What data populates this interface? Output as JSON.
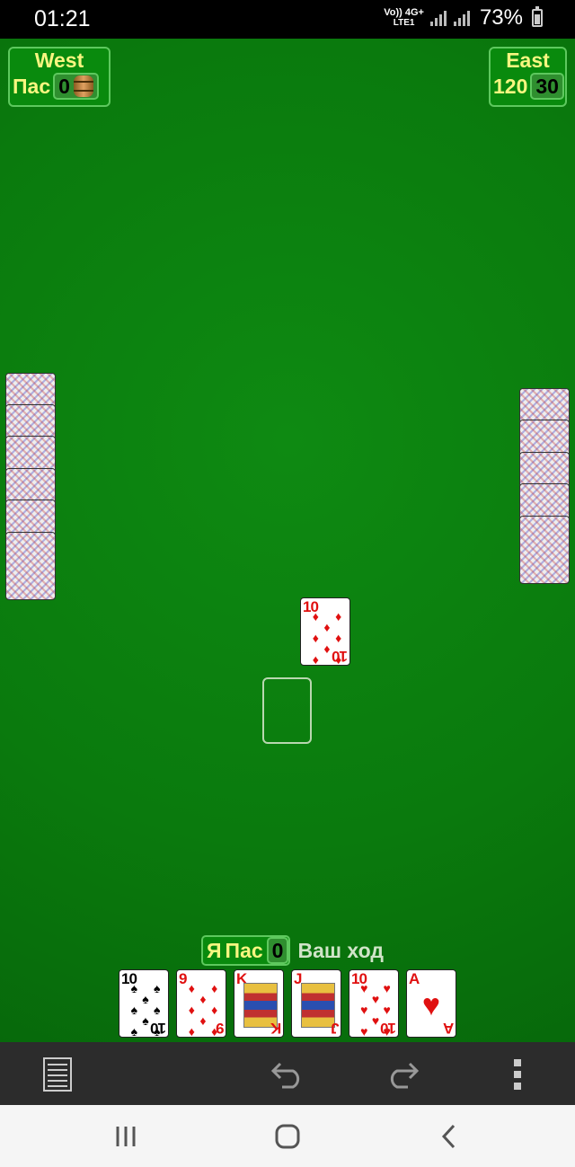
{
  "status_bar": {
    "time": "01:21",
    "network_top": "Vo)) 4G+",
    "network_bottom": "LTE1",
    "battery": "73%"
  },
  "players": {
    "west": {
      "name": "West",
      "status": "Пас",
      "score": "0",
      "icon": "barrel-icon"
    },
    "east": {
      "name": "East",
      "status": "120",
      "score": "30"
    },
    "me": {
      "name": "Я",
      "status": "Пас",
      "score": "0",
      "message": "Ваш ход"
    }
  },
  "played_card": {
    "rank": "10",
    "suit": "♦",
    "color": "red"
  },
  "hand": [
    {
      "rank": "10",
      "suit": "♠",
      "color": "black"
    },
    {
      "rank": "9",
      "suit": "♦",
      "color": "red"
    },
    {
      "rank": "K",
      "suit": "♦",
      "color": "red"
    },
    {
      "rank": "J",
      "suit": "♦",
      "color": "red"
    },
    {
      "rank": "10",
      "suit": "♥",
      "color": "red"
    },
    {
      "rank": "A",
      "suit": "♥",
      "color": "red"
    }
  ],
  "toolbar": [
    "menu-icon",
    "undo-icon",
    "redo-icon",
    "more-vertical-icon"
  ],
  "navbar": [
    "recent-apps-icon",
    "home-icon",
    "back-icon"
  ],
  "colors": {
    "table": "#0a7a0d",
    "label": "#f8f680",
    "toolbar": "#2c2c2c"
  }
}
